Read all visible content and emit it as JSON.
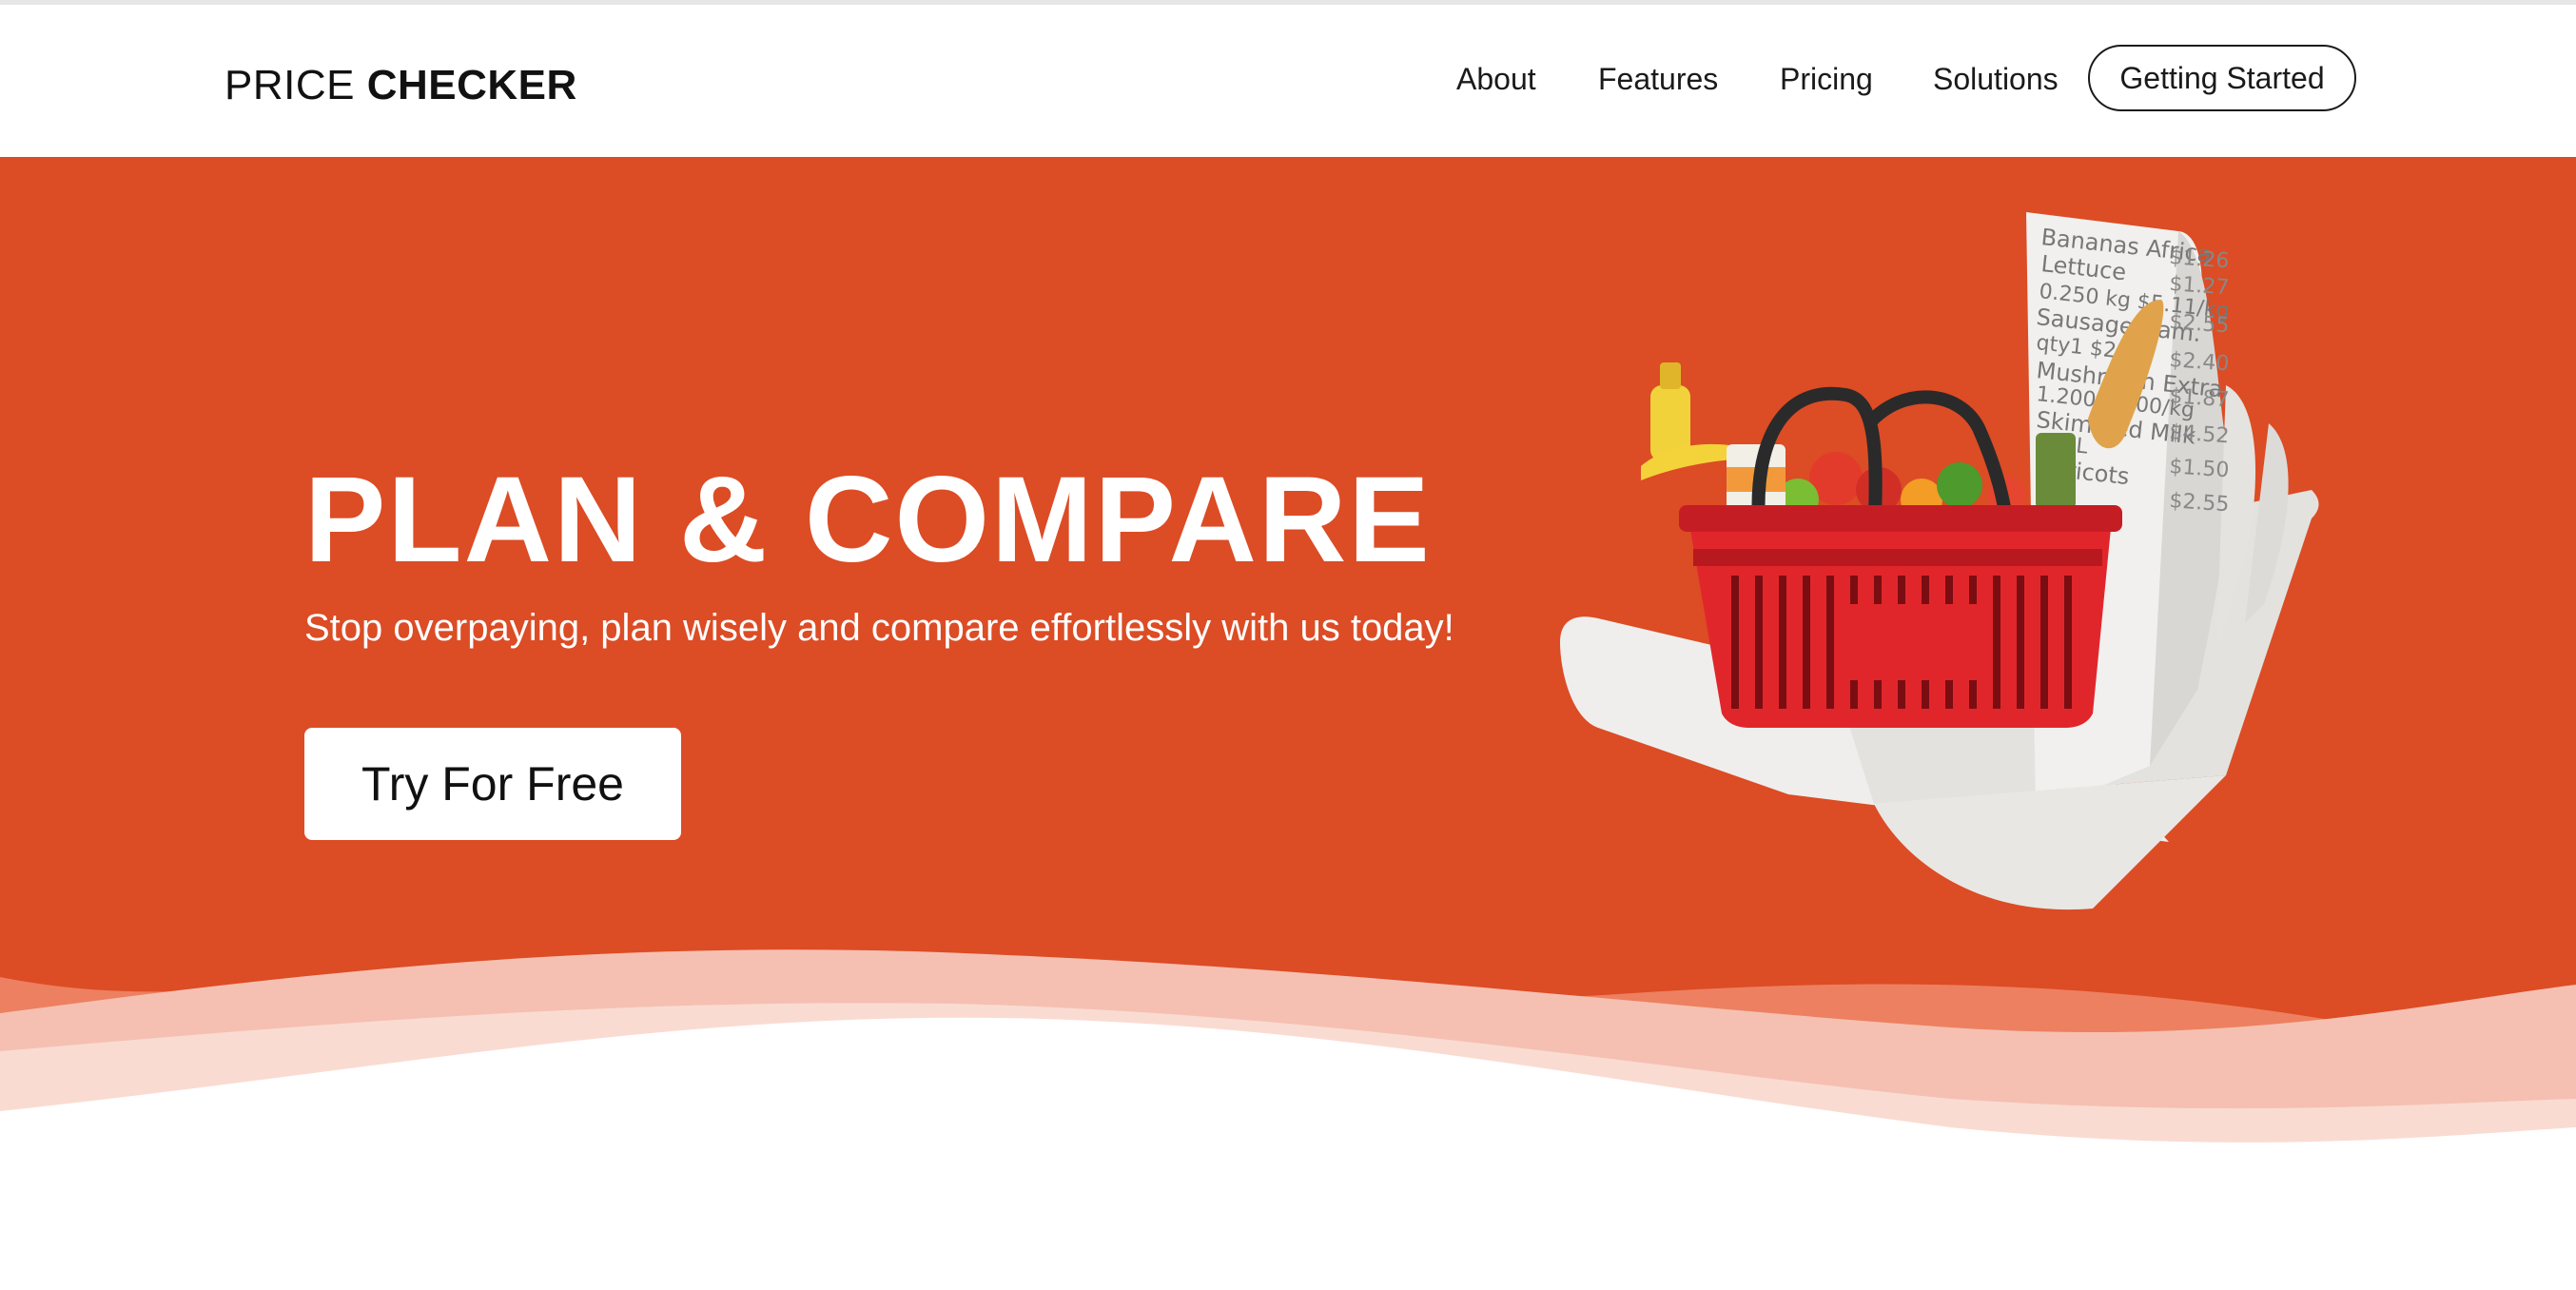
{
  "header": {
    "logo_light": "PRICE",
    "logo_bold": "CHECKER",
    "nav": [
      "About",
      "Features",
      "Pricing",
      "Solutions"
    ],
    "cta": "Getting Started"
  },
  "hero": {
    "title": "PLAN & COMPARE",
    "subtitle": "Stop overpaying, plan wisely and compare effortlessly with us today!",
    "button": "Try For Free",
    "background_color": "#dc4c25",
    "illustration": "grocery-basket-receipt-icon"
  },
  "receipt": {
    "items": [
      "Bananas Africa",
      "Lettuce",
      "0.250 kg  $5.11/kg",
      "Sausage Ham.",
      "qty1  $2.55",
      "Mushroom Extra",
      "1.200   $2.00/kg",
      "Skimmed Milk",
      "2.0 L",
      "Apricots"
    ],
    "prices": [
      "$1.26",
      "$1.27",
      "$2.55",
      "$2.40",
      "$1.87",
      "$4.52",
      "$1.50",
      "$2.55"
    ]
  }
}
